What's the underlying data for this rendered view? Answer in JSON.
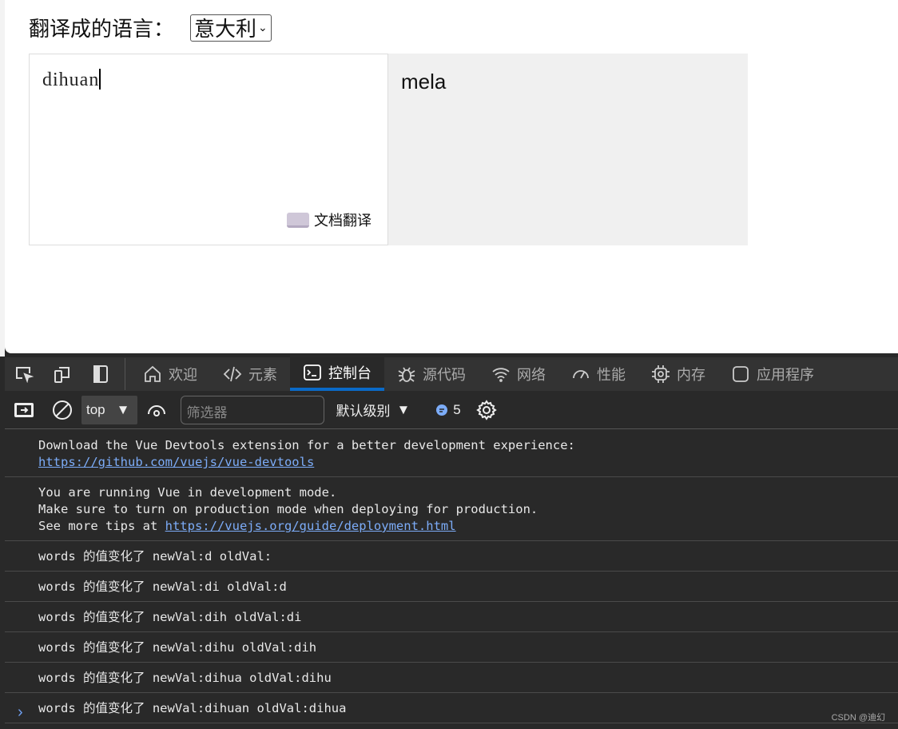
{
  "page": {
    "lang_label": "翻译成的语言：",
    "lang_selected": "意大利",
    "input_text": "dihuan",
    "doc_translate": "文档翻译",
    "output_text": "mela"
  },
  "devtools": {
    "tabs": [
      {
        "label": "欢迎",
        "icon": "home-icon"
      },
      {
        "label": "元素",
        "icon": "code-icon"
      },
      {
        "label": "控制台",
        "icon": "console-icon",
        "active": true
      },
      {
        "label": "源代码",
        "icon": "bug-icon"
      },
      {
        "label": "网络",
        "icon": "wifi-icon"
      },
      {
        "label": "性能",
        "icon": "gauge-icon"
      },
      {
        "label": "内存",
        "icon": "chip-icon"
      },
      {
        "label": "应用程序",
        "icon": "app-icon"
      }
    ],
    "context": "top",
    "filter_placeholder": "筛选器",
    "levels": "默认级别",
    "message_count": "5",
    "accent": "#0a6ac8"
  },
  "console": {
    "messages": [
      {
        "lines": [
          "Download the Vue Devtools extension for a better development experience:"
        ],
        "link": "https://github.com/vuejs/vue-devtools"
      },
      {
        "lines": [
          "You are running Vue in development mode.",
          "Make sure to turn on production mode when deploying for production."
        ],
        "prefix": "See more tips at ",
        "link": "https://vuejs.org/guide/deployment.html"
      },
      {
        "lines": [
          "words 的值变化了 newVal:d oldVal:"
        ]
      },
      {
        "lines": [
          "words 的值变化了 newVal:di oldVal:d"
        ]
      },
      {
        "lines": [
          "words 的值变化了 newVal:dih oldVal:di"
        ]
      },
      {
        "lines": [
          "words 的值变化了 newVal:dihu oldVal:dih"
        ]
      },
      {
        "lines": [
          "words 的值变化了 newVal:dihua oldVal:dihu"
        ]
      },
      {
        "lines": [
          "words 的值变化了 newVal:dihuan oldVal:dihua"
        ]
      }
    ]
  },
  "watermark": "CSDN @迪幻"
}
